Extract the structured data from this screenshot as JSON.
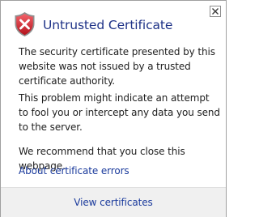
{
  "dialog": {
    "title": "Untrusted Certificate",
    "close_icon": "close-icon",
    "shield_icon": "shield-error-icon",
    "paragraphs": [
      "The security certificate presented by this website was not issued by a trusted certificate authority.",
      "This problem might indicate an attempt to fool you or intercept any data you send to the server.",
      "We recommend that you close this webpage."
    ],
    "about_link": "About certificate errors",
    "footer_link": "View certificates"
  },
  "colors": {
    "title": "#1e3287",
    "link": "#1a3a9c",
    "shield": "#d0202a",
    "footer_bg": "#f0f0f0"
  }
}
